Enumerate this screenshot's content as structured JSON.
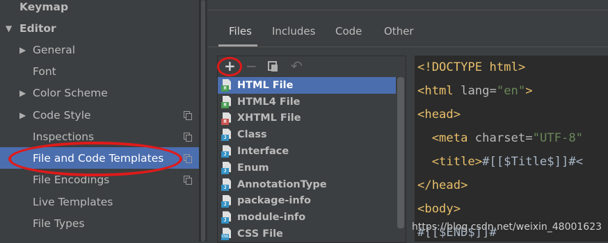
{
  "sidebar": {
    "items": [
      {
        "label": "Keymap",
        "expanded": null,
        "has_copy_icon": false
      },
      {
        "label": "Editor",
        "expanded": true,
        "has_copy_icon": false
      },
      {
        "label": "General",
        "expanded": false,
        "has_copy_icon": false
      },
      {
        "label": "Font",
        "expanded": null,
        "has_copy_icon": false
      },
      {
        "label": "Color Scheme",
        "expanded": false,
        "has_copy_icon": false
      },
      {
        "label": "Code Style",
        "expanded": false,
        "has_copy_icon": true
      },
      {
        "label": "Inspections",
        "expanded": null,
        "has_copy_icon": true
      },
      {
        "label": "File and Code Templates",
        "expanded": null,
        "has_copy_icon": true,
        "selected": true
      },
      {
        "label": "File Encodings",
        "expanded": null,
        "has_copy_icon": true
      },
      {
        "label": "Live Templates",
        "expanded": null,
        "has_copy_icon": false
      },
      {
        "label": "File Types",
        "expanded": null,
        "has_copy_icon": false
      }
    ]
  },
  "tabs": [
    {
      "label": "Files",
      "active": true
    },
    {
      "label": "Includes",
      "active": false
    },
    {
      "label": "Code",
      "active": false
    },
    {
      "label": "Other",
      "active": false
    }
  ],
  "toolbar": {
    "icons": [
      "add-icon",
      "remove-icon",
      "copy-icon",
      "reset-icon"
    ]
  },
  "templates": [
    {
      "name": "HTML File",
      "icon": "html-file-icon",
      "badge": "H",
      "badge_color": "#499c54",
      "selected": true
    },
    {
      "name": "HTML4 File",
      "icon": "html-file-icon",
      "badge": "H",
      "badge_color": "#499c54"
    },
    {
      "name": "XHTML File",
      "icon": "xhtml-file-icon",
      "badge": "H",
      "badge_color": "#c75450"
    },
    {
      "name": "Class",
      "icon": "java-file-icon",
      "badge": "J",
      "badge_color": "#3592c4"
    },
    {
      "name": "Interface",
      "icon": "java-file-icon",
      "badge": "J",
      "badge_color": "#3592c4"
    },
    {
      "name": "Enum",
      "icon": "java-file-icon",
      "badge": "J",
      "badge_color": "#3592c4"
    },
    {
      "name": "AnnotationType",
      "icon": "java-file-icon",
      "badge": "J",
      "badge_color": "#3592c4"
    },
    {
      "name": "package-info",
      "icon": "java-file-icon",
      "badge": "J",
      "badge_color": "#3592c4"
    },
    {
      "name": "module-info",
      "icon": "java-file-icon",
      "badge": "J",
      "badge_color": "#3592c4"
    },
    {
      "name": "CSS File",
      "icon": "css-file-icon",
      "badge": "CSS",
      "badge_color": "#3592c4"
    }
  ],
  "editor": {
    "lines": [
      {
        "tag_open": "<!DOCTYPE html>",
        "attr": "",
        "value": "",
        "tag_close": "",
        "text": ""
      },
      {
        "tag_open": "<html ",
        "attr": "lang=",
        "value": "\"en\"",
        "tag_close": ">",
        "text": ""
      },
      {
        "tag_open": "<head>",
        "attr": "",
        "value": "",
        "tag_close": "",
        "text": ""
      },
      {
        "tag_open": "  <meta ",
        "attr": "charset=",
        "value": "\"UTF-8\"",
        "tag_close": "",
        "text": ""
      },
      {
        "tag_open": "  <title>",
        "attr": "",
        "value": "",
        "tag_close": "",
        "text": "#[[$Title$]]#<"
      },
      {
        "tag_open": "</head>",
        "attr": "",
        "value": "",
        "tag_close": "",
        "text": ""
      },
      {
        "tag_open": "<body>",
        "attr": "",
        "value": "",
        "tag_close": "",
        "text": ""
      },
      {
        "tag_open": "",
        "attr": "",
        "value": "",
        "tag_close": "",
        "text": "#[[$END$]]#"
      }
    ]
  },
  "watermark": "https://blog.csdn.net/weixin_48001623",
  "colors": {
    "background": "#3c3f41",
    "selection": "#4b6eaf",
    "editor_bg": "#2b2b2b",
    "tag": "#e8bf6a",
    "string": "#6a8759",
    "annotation_red": "#e11a1a"
  }
}
